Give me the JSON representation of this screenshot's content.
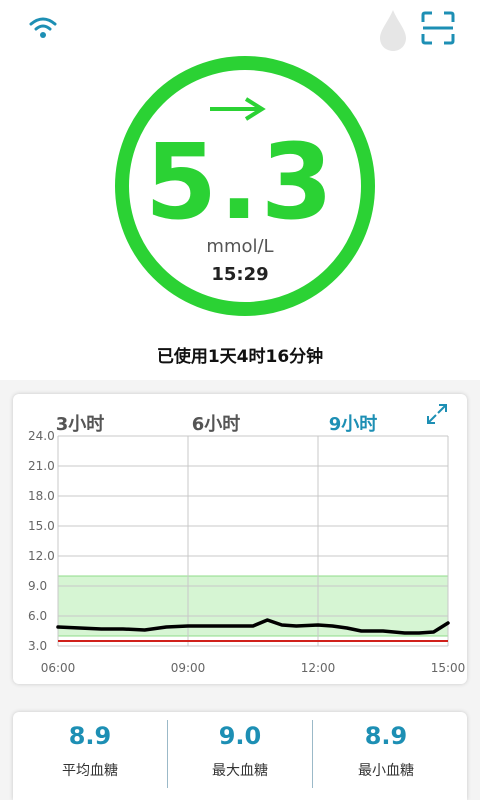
{
  "reading": {
    "value": "5.3",
    "unit": "mmol/L",
    "time": "15:29",
    "trend": "arrow-right-icon",
    "ring_color": "#2bd234"
  },
  "sensor": {
    "usage_text": "已使用1天4时16分钟"
  },
  "chart": {
    "tabs": [
      "3小时",
      "6小时",
      "9小时"
    ],
    "active_tab": 2
  },
  "chart_data": {
    "type": "line",
    "x_ticks": [
      "06:00",
      "09:00",
      "12:00",
      "15:00"
    ],
    "y_ticks": [
      "24.0",
      "21.0",
      "18.0",
      "15.0",
      "12.0",
      "9.0",
      "6.0",
      "3.0"
    ],
    "xlim": [
      "06:00",
      "15:00"
    ],
    "ylim": [
      3.0,
      24.0
    ],
    "target_range": [
      4.0,
      10.0
    ],
    "low_threshold": 3.5,
    "grid": true,
    "series": [
      {
        "x": [
          "06:00",
          "06:30",
          "07:00",
          "07:30",
          "08:00",
          "08:30",
          "09:00",
          "09:30",
          "10:00",
          "10:30",
          "10:50",
          "11:10",
          "11:30",
          "12:00",
          "12:20",
          "12:40",
          "13:00",
          "13:30",
          "14:00",
          "14:20",
          "14:40",
          "15:00"
        ],
        "y": [
          4.9,
          4.8,
          4.7,
          4.7,
          4.6,
          4.9,
          5.0,
          5.0,
          5.0,
          5.0,
          5.6,
          5.1,
          5.0,
          5.1,
          5.0,
          4.8,
          4.5,
          4.5,
          4.3,
          4.3,
          4.4,
          5.3
        ],
        "color": "#000000"
      }
    ],
    "colors": {
      "target_fill": "#d6f5d3",
      "target_line": "#8fdc8a",
      "low_line": "#d0201b"
    }
  },
  "stats": [
    {
      "value": "8.9",
      "label": "平均血糖"
    },
    {
      "value": "9.0",
      "label": "最大血糖"
    },
    {
      "value": "8.9",
      "label": "最小血糖"
    }
  ]
}
